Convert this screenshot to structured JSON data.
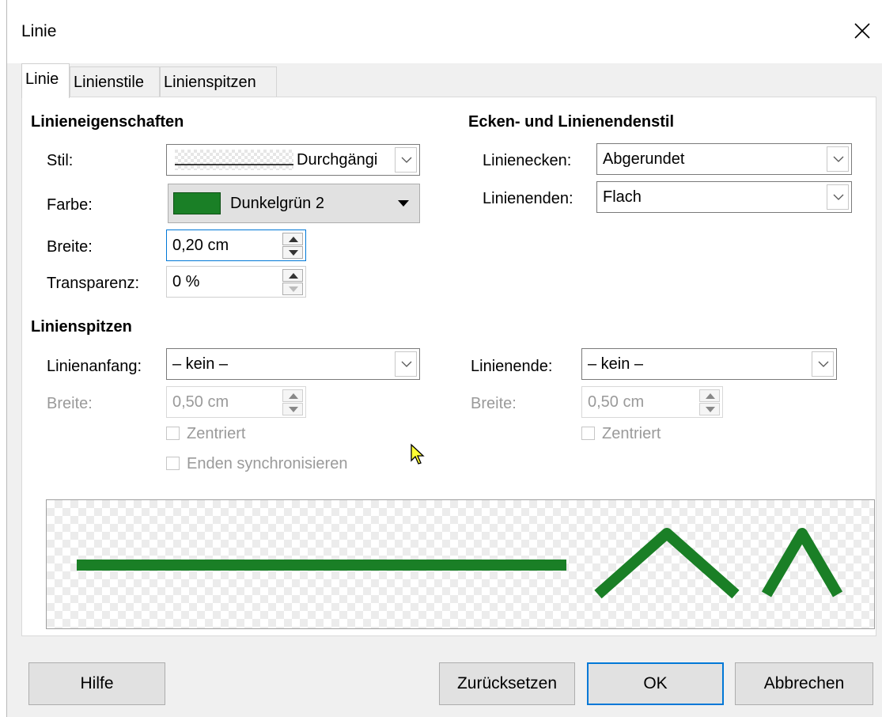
{
  "dialog": {
    "title": "Linie"
  },
  "tabs": [
    {
      "label": "Linie"
    },
    {
      "label": "Linienstile"
    },
    {
      "label": "Linienspitzen"
    }
  ],
  "properties": {
    "heading": "Linieneigenschaften",
    "style_label": "Stil:",
    "style_value": "Durchgängi",
    "color_label": "Farbe:",
    "color_value": "Dunkelgrün 2",
    "color_hex": "#1a7f26",
    "width_label": "Breite:",
    "width_value": "0,20 cm",
    "transparency_label": "Transparenz:",
    "transparency_value": "0 %"
  },
  "corners": {
    "heading": "Ecken- und Linienendenstil",
    "corner_label": "Linienecken:",
    "corner_value": "Abgerundet",
    "cap_label": "Linienenden:",
    "cap_value": "Flach"
  },
  "arrows": {
    "heading": "Linienspitzen",
    "start_label": "Linienanfang:",
    "start_value": "– kein –",
    "start_width_label": "Breite:",
    "start_width_value": "0,50 cm",
    "start_centered": "Zentriert",
    "sync_ends": "Enden synchronisieren",
    "end_label": "Linienende:",
    "end_value": "– kein –",
    "end_width_label": "Breite:",
    "end_width_value": "0,50 cm",
    "end_centered": "Zentriert"
  },
  "buttons": {
    "help": "Hilfe",
    "reset": "Zurücksetzen",
    "ok": "OK",
    "cancel": "Abbrechen"
  }
}
